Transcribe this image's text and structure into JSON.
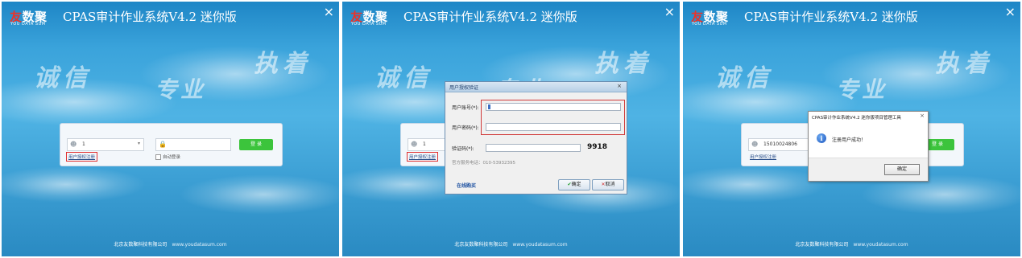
{
  "app": {
    "brand_you": "友",
    "brand_rest": "数聚",
    "brand_sub": "YOU DATA SUM",
    "title": "CPAS审计作业系统V4.2 迷你版",
    "close_symbol": "×"
  },
  "slogans": {
    "s1": "诚信",
    "s2": "专业",
    "s3": "执着"
  },
  "footer": {
    "company": "北京友数聚科技有限公司",
    "url": "www.youdatasum.com"
  },
  "login": {
    "username_panel1": "1",
    "username_panel2": "1",
    "username_panel3": "15010024806",
    "login_button": "登 录",
    "register_link": "用户授权注册",
    "auto_login": "自动登录"
  },
  "auth_dialog": {
    "title": "用户授权验证",
    "close_symbol": "×",
    "account_label": "用户账号(*):",
    "password_label": "用户密码(*):",
    "captcha_label": "验证码(*):",
    "captcha_value": "9918",
    "phone_text": "官方服务电话：010-53932395",
    "buy_link": "在线购买",
    "ok_icon": "✔",
    "ok_label": "确定",
    "cancel_icon": "✕",
    "cancel_label": "取消"
  },
  "message_box": {
    "title": "CPAS审计作业系统V4.2 迷你版项目管理工具",
    "close_symbol": "×",
    "icon": "info-icon",
    "text": "注册用户成功！",
    "ok_label": "确定"
  },
  "colors": {
    "background_blue": "#3aa3db",
    "login_green": "#3cc43c",
    "highlight_red": "#e03030",
    "brand_red": "#e8332a"
  }
}
